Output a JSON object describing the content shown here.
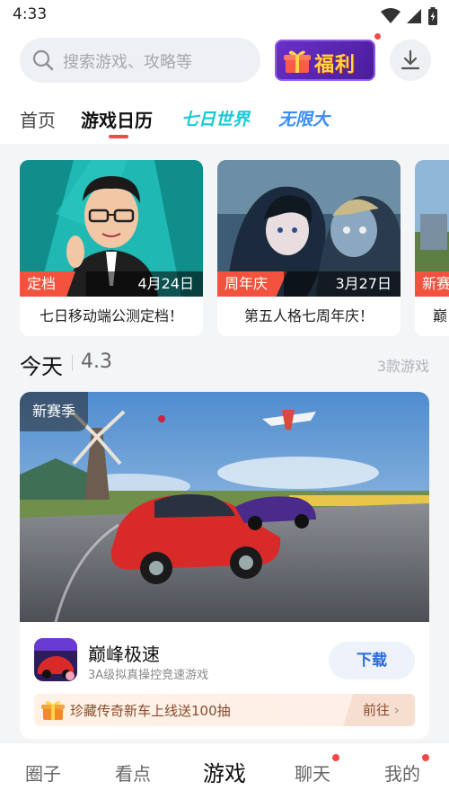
{
  "status": {
    "time": "4:33",
    "icons": [
      "wifi-icon",
      "signal-icon",
      "battery-icon"
    ]
  },
  "header": {
    "search_placeholder": "搜索游戏、攻略等",
    "fuli_label": "福利",
    "tabs": [
      {
        "label": "首页",
        "active": false
      },
      {
        "label": "游戏日历",
        "active": true
      },
      {
        "label": "七日世界",
        "active": false
      },
      {
        "label": "无限大",
        "active": false
      }
    ]
  },
  "events": [
    {
      "tag": "定档",
      "date": "4月24日",
      "title": "七日移动端公测定档！"
    },
    {
      "tag": "周年庆",
      "date": "3月27日",
      "title": "第五人格七周年庆！"
    },
    {
      "tag": "新赛",
      "date": "",
      "title": "巅"
    }
  ],
  "today": {
    "label": "今天",
    "date": "4.3",
    "count": "3款游戏"
  },
  "game": {
    "season_badge": "新赛季",
    "name": "巅峰极速",
    "desc": "3A级拟真操控竞速游戏",
    "download": "下载",
    "promo_text": "珍藏传奇新车上线送100抽",
    "promo_go": "前往"
  },
  "bottom_nav": [
    {
      "label": "圈子",
      "active": false,
      "dot": false
    },
    {
      "label": "看点",
      "active": false,
      "dot": false
    },
    {
      "label": "游戏",
      "active": true,
      "dot": false
    },
    {
      "label": "聊天",
      "active": false,
      "dot": true
    },
    {
      "label": "我的",
      "active": false,
      "dot": true
    }
  ],
  "colors": {
    "accent_red": "#f24a4a",
    "download_blue": "#2a6ad9",
    "brand_cyan": "#19c9d4",
    "brand_blue": "#3c8cf2"
  }
}
